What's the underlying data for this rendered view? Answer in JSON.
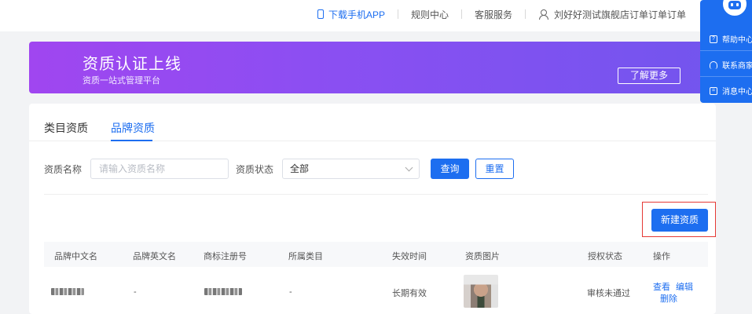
{
  "topbar": {
    "download_app": "下载手机APP",
    "rules_center": "规则中心",
    "customer_service": "客服服务",
    "user_name": "刘好好测试旗舰店订单订单订单"
  },
  "banner": {
    "title": "资质认证上线",
    "subtitle": "资质一站式管理平台",
    "learn_more": "了解更多"
  },
  "tabs": [
    {
      "label": "类目资质",
      "active": false
    },
    {
      "label": "品牌资质",
      "active": true
    }
  ],
  "filters": {
    "name_label": "资质名称",
    "name_placeholder": "请输入资质名称",
    "status_label": "资质状态",
    "status_value": "全部",
    "query_label": "查询",
    "reset_label": "重置"
  },
  "new_button": "新建资质",
  "table": {
    "columns": [
      "品牌中文名",
      "品牌英文名",
      "商标注册号",
      "所属类目",
      "失效时间",
      "资质图片",
      "授权状态",
      "操作"
    ],
    "rows": [
      {
        "brand_cn": "",
        "brand_en": "-",
        "trademark_no": "",
        "category": "-",
        "expire": "长期有效",
        "auth_status": "审核未通过",
        "actions": [
          "查看",
          "编辑",
          "删除"
        ]
      }
    ]
  },
  "float_panel": {
    "items": [
      "帮助中心",
      "联系商家",
      "消息中心"
    ]
  },
  "colors": {
    "primary": "#1d6ef0",
    "highlight": "#e53935",
    "banner_start": "#a046f0",
    "banner_end": "#7355ee"
  }
}
